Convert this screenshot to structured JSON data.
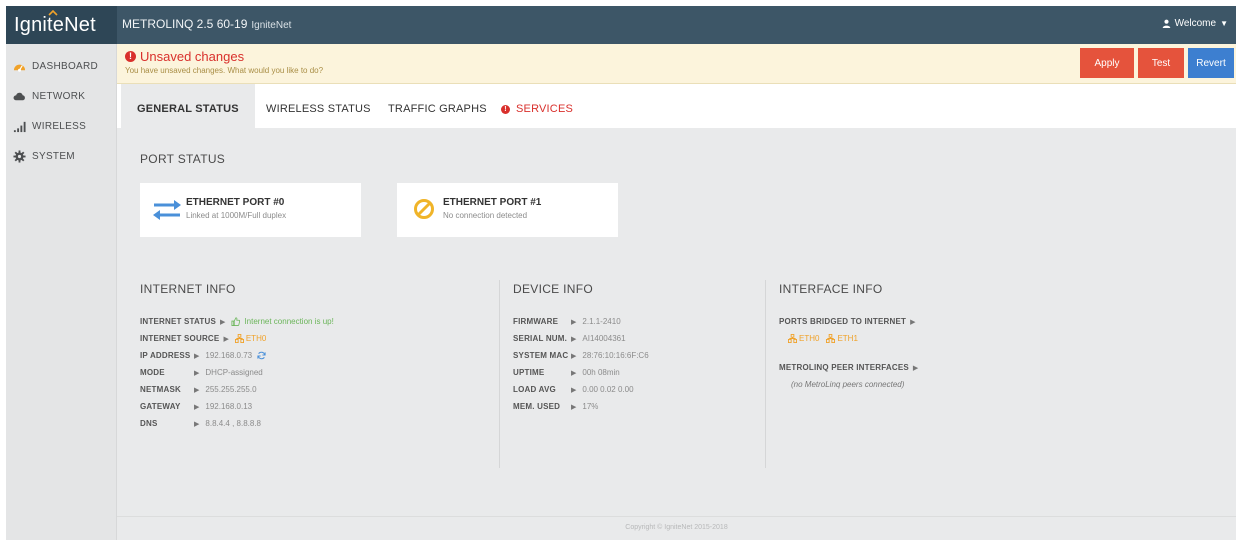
{
  "app": {
    "brand": "IgniteNet",
    "product": "METROLINQ 2.5 60-19",
    "product_sub": "IgniteNet",
    "welcome": "Welcome"
  },
  "sidebar": {
    "items": [
      {
        "label": "DASHBOARD",
        "icon": "dashboard-icon"
      },
      {
        "label": "NETWORK",
        "icon": "cloud-icon"
      },
      {
        "label": "WIRELESS",
        "icon": "signal-icon"
      },
      {
        "label": "SYSTEM",
        "icon": "gear-icon"
      }
    ]
  },
  "banner": {
    "title": "Unsaved changes",
    "text": "You have unsaved changes. What would you like to do?",
    "apply": "Apply",
    "test": "Test",
    "revert": "Revert"
  },
  "tabs": [
    "GENERAL STATUS",
    "WIRELESS STATUS",
    "TRAFFIC GRAPHS",
    "SERVICES"
  ],
  "port_status": {
    "title": "PORT STATUS",
    "ports": [
      {
        "name": "ETHERNET PORT #0",
        "status": "Linked at 1000M/Full duplex"
      },
      {
        "name": "ETHERNET PORT #1",
        "status": "No connection detected"
      }
    ]
  },
  "internet_info": {
    "title": "INTERNET INFO",
    "rows": [
      {
        "key": "INTERNET STATUS",
        "value": "Internet connection is up!"
      },
      {
        "key": "INTERNET SOURCE",
        "value": "ETH0"
      },
      {
        "key": "IP ADDRESS",
        "value": "192.168.0.73"
      },
      {
        "key": "MODE",
        "value": "DHCP-assigned"
      },
      {
        "key": "NETMASK",
        "value": "255.255.255.0"
      },
      {
        "key": "GATEWAY",
        "value": "192.168.0.13"
      },
      {
        "key": "DNS",
        "value": "8.8.4.4 , 8.8.8.8"
      }
    ]
  },
  "device_info": {
    "title": "DEVICE INFO",
    "rows": [
      {
        "key": "FIRMWARE",
        "value": "2.1.1-2410"
      },
      {
        "key": "SERIAL NUM.",
        "value": "AI14004361"
      },
      {
        "key": "SYSTEM MAC",
        "value": "28:76:10:16:6F:C6"
      },
      {
        "key": "UPTIME",
        "value": "00h 08min"
      },
      {
        "key": "LOAD AVG",
        "value": "0.00 0.02 0.00"
      },
      {
        "key": "MEM. USED",
        "value": "17%"
      }
    ]
  },
  "interface_info": {
    "title": "INTERFACE INFO",
    "bridged_label": "PORTS BRIDGED TO INTERNET",
    "bridged_ports": [
      "ETH0",
      "ETH1"
    ],
    "peer_label": "METROLINQ PEER INTERFACES",
    "peer_value": "(no MetroLinq peers connected)"
  },
  "footer": "Copyright © IgniteNet 2015-2018",
  "colors": {
    "topbar": "#3d5667",
    "alert": "#d9302c",
    "apply": "#e5533c",
    "revert": "#3d7fd0",
    "ok_green": "#6bb55a",
    "port_orange": "#f0a22a"
  }
}
